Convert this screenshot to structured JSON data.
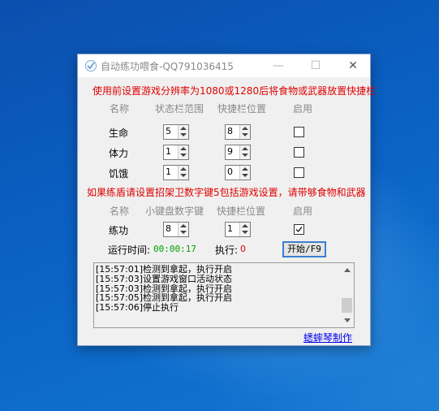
{
  "window": {
    "title": "自动练功喂食-QQ791036415",
    "minimize_glyph": "—",
    "maximize_glyph": "☐",
    "close_glyph": "✕"
  },
  "notice1": "使用前设置游戏分辨率为1080或1280后将食物或武器放置快捷栏",
  "table1": {
    "headers": [
      "名称",
      "状态栏范围",
      "快捷栏位置",
      "启用"
    ],
    "rows": [
      {
        "name": "生命",
        "range": "5",
        "slot": "8",
        "enabled": false
      },
      {
        "name": "体力",
        "range": "1",
        "slot": "9",
        "enabled": false
      },
      {
        "name": "饥饿",
        "range": "1",
        "slot": "0",
        "enabled": false
      }
    ]
  },
  "notice2": "如果练盾请设置招架卫数字键5包括游戏设置，请带够食物和武器",
  "table2": {
    "headers": [
      "名称",
      "小键盘数字键",
      "快捷栏位置",
      "启用"
    ],
    "row": {
      "name": "练功",
      "key": "8",
      "slot": "1",
      "enabled": true
    }
  },
  "status": {
    "runtime_label": "运行时间:",
    "runtime_value": "00:00:17",
    "exec_label": "执行:",
    "exec_value": "0",
    "start_button": "开始/F9"
  },
  "log": [
    "[15:57:01]检测到拿起，执行开启",
    "[15:57:03]设置游戏窗口活动状态",
    "[15:57:03]检测到拿起，执行开启",
    "[15:57:05]检测到拿起，执行开启",
    "[15:57:06]停止执行"
  ],
  "footer_link": "蟋蟀琴制作",
  "colors": {
    "notice": "#e00000",
    "runtime": "#00a000",
    "exec_count": "#e00000",
    "link": "#0000ee",
    "button_border": "#3c7fd0"
  }
}
